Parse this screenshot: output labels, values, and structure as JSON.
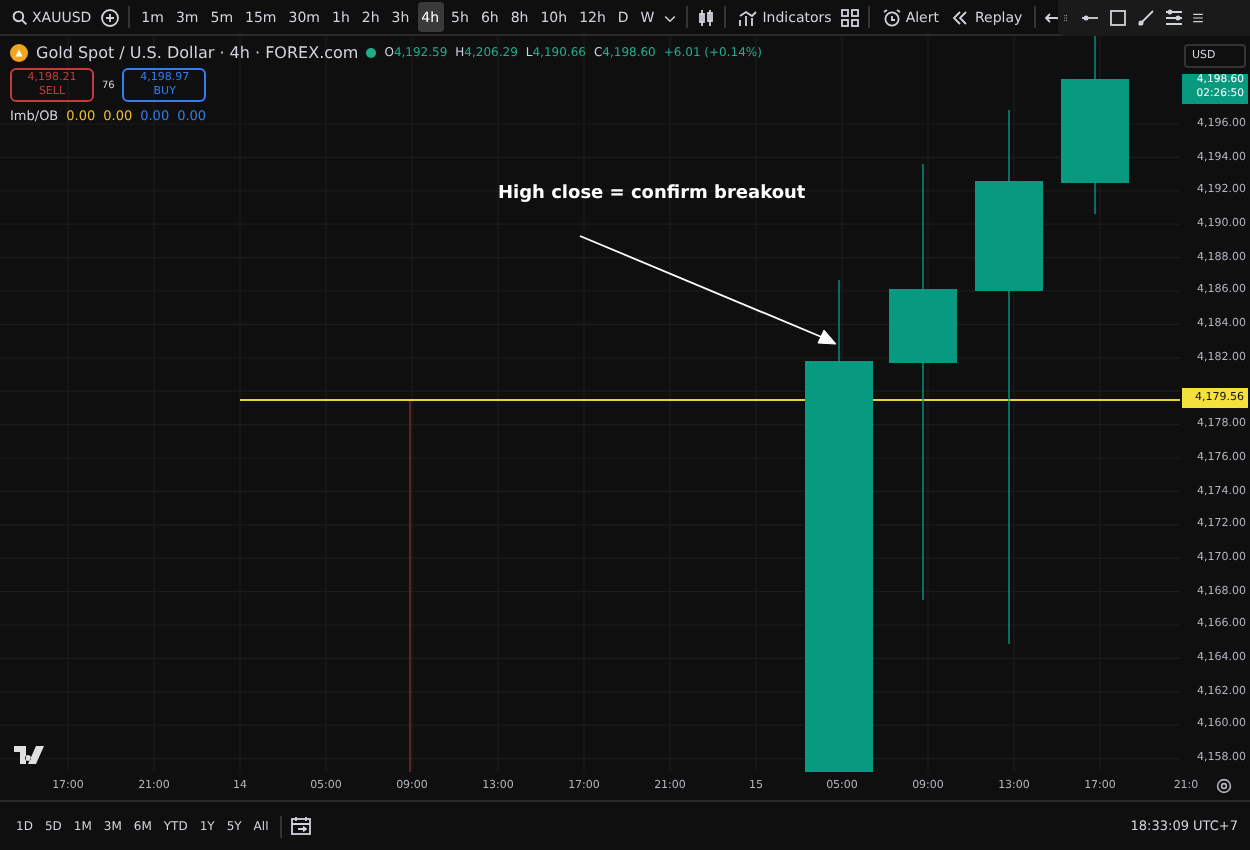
{
  "toolbar": {
    "symbol": "XAUUSD",
    "intervals": [
      {
        "label": "1m",
        "selected": false
      },
      {
        "label": "3m",
        "selected": false
      },
      {
        "label": "5m",
        "selected": false
      },
      {
        "label": "15m",
        "selected": false
      },
      {
        "label": "30m",
        "selected": false
      },
      {
        "label": "1h",
        "selected": false
      },
      {
        "label": "2h",
        "selected": false
      },
      {
        "label": "3h",
        "selected": false
      },
      {
        "label": "4h",
        "selected": true
      },
      {
        "label": "5h",
        "selected": false
      },
      {
        "label": "6h",
        "selected": false
      },
      {
        "label": "8h",
        "selected": false
      },
      {
        "label": "10h",
        "selected": false
      },
      {
        "label": "12h",
        "selected": false
      },
      {
        "label": "D",
        "selected": false
      },
      {
        "label": "W",
        "selected": false
      }
    ],
    "indicators": "Indicators",
    "alert": "Alert",
    "replay": "Replay"
  },
  "legend": {
    "title": "Gold Spot / U.S. Dollar · 4h · FOREX.com",
    "ohlc": [
      {
        "key": "O",
        "value": "4,192.59"
      },
      {
        "key": "H",
        "value": "4,206.29"
      },
      {
        "key": "L",
        "value": "4,190.66"
      },
      {
        "key": "C",
        "value": "4,198.60"
      }
    ],
    "change": "+6.01 (+0.14%)",
    "sell": {
      "price": "4,198.21",
      "label": "SELL"
    },
    "spread": "76",
    "buy": {
      "price": "4,198.97",
      "label": "BUY"
    },
    "indicator": {
      "name": "Imb/OB",
      "values": [
        {
          "text": "0.00",
          "color": "#f2c12e"
        },
        {
          "text": "0.00",
          "color": "#f2c12e"
        },
        {
          "text": "0.00",
          "color": "#2f7ff0"
        },
        {
          "text": "0.00",
          "color": "#2f7ff0"
        }
      ]
    }
  },
  "annotation": "High close = confirm breakout",
  "price_axis": {
    "currency": "USD",
    "last_price": "4,198.60",
    "countdown": "02:26:50",
    "line_price": "4,179.56",
    "ticks_above_line": [
      "4,196.00",
      "4,194.00",
      "4,192.00",
      "4,190.00",
      "4,188.00",
      "4,186.00",
      "4,184.00",
      "4,182.00"
    ],
    "ticks_below_line": [
      "4,178.00",
      "4,176.00",
      "4,174.00",
      "4,172.00",
      "4,170.00",
      "4,168.00",
      "4,166.00",
      "4,164.00",
      "4,162.00",
      "4,160.00",
      "4,158.00"
    ]
  },
  "time_axis": [
    "17:00",
    "21:00",
    "14",
    "05:00",
    "09:00",
    "13:00",
    "17:00",
    "21:00",
    "15",
    "05:00",
    "09:00",
    "13:00",
    "17:00",
    "21:0"
  ],
  "ranges": [
    "1D",
    "5D",
    "1M",
    "3M",
    "6M",
    "YTD",
    "1Y",
    "5Y",
    "All"
  ],
  "clock": "18:33:09 UTC+7"
}
